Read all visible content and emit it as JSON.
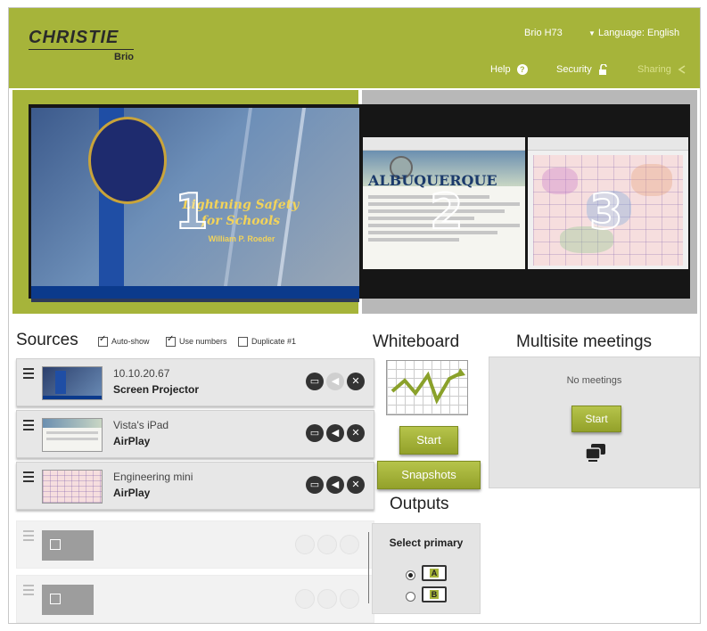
{
  "brand": {
    "logo": "CHRISTIE",
    "product": "Brio"
  },
  "header": {
    "device_name": "Brio H73",
    "language_label": "Language: English",
    "help_label": "Help",
    "security_label": "Security",
    "sharing_label": "Sharing"
  },
  "preview": {
    "tiles": [
      {
        "number": "1",
        "slide_title": "Lightning Safety for Schools",
        "slide_author": "William P. Roeder"
      },
      {
        "number": "2",
        "banner_text": "ALBUQUERQUE"
      },
      {
        "number": "3"
      }
    ]
  },
  "sources": {
    "title": "Sources",
    "options": [
      {
        "label": "Auto-show",
        "checked": true
      },
      {
        "label": "Use numbers",
        "checked": true
      },
      {
        "label": "Duplicate #1",
        "checked": false
      }
    ],
    "items": [
      {
        "name": "10.10.20.67",
        "type": "Screen Projector"
      },
      {
        "name": "Vista's iPad",
        "type": "AirPlay"
      },
      {
        "name": "Engineering mini",
        "type": "AirPlay"
      }
    ]
  },
  "whiteboard": {
    "title": "Whiteboard",
    "start_label": "Start",
    "snapshots_label": "Snapshots"
  },
  "outputs": {
    "title": "Outputs",
    "select_label": "Select primary",
    "displays": [
      {
        "label": "A",
        "selected": true
      },
      {
        "label": "B",
        "selected": false
      }
    ]
  },
  "multisite": {
    "title": "Multisite meetings",
    "status": "No meetings",
    "start_label": "Start"
  },
  "colors": {
    "accent": "#a6b43a",
    "header_text": "#ffffff"
  }
}
